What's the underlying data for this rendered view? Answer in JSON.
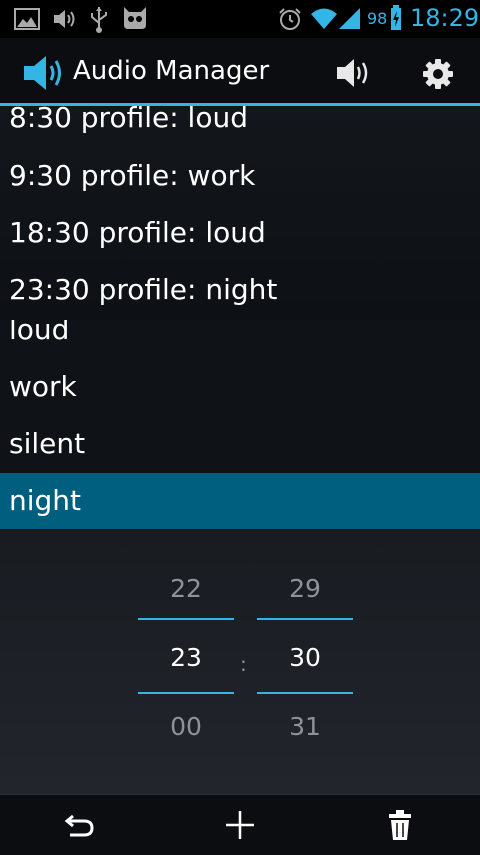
{
  "status_bar": {
    "battery": "98",
    "time": "18:29"
  },
  "action_bar": {
    "title": "Audio Manager"
  },
  "schedule": [
    {
      "label": "8:30 profile: loud"
    },
    {
      "label": "9:30 profile: work"
    },
    {
      "label": "18:30 profile: loud"
    },
    {
      "label": "23:30 profile: night"
    }
  ],
  "profiles": [
    {
      "label": "loud",
      "selected": false
    },
    {
      "label": "work",
      "selected": false
    },
    {
      "label": "silent",
      "selected": false
    },
    {
      "label": "night",
      "selected": true
    }
  ],
  "time_picker": {
    "hour_prev": "22",
    "hour": "23",
    "hour_next": "00",
    "separator": ":",
    "minute_prev": "29",
    "minute": "30",
    "minute_next": "31"
  },
  "icons": {
    "status": [
      "gallery-icon",
      "volume-icon",
      "usb-icon",
      "cyanogen-icon",
      "alarm-icon",
      "wifi-icon",
      "signal-icon",
      "battery-charging-icon"
    ],
    "action_bar": [
      "speaker-logo-icon",
      "volume-icon",
      "settings-icon"
    ],
    "bottom_bar": [
      "undo-icon",
      "add-icon",
      "delete-icon"
    ]
  },
  "colors": {
    "accent": "#33b5e5",
    "selected_row": "#005f7f"
  }
}
